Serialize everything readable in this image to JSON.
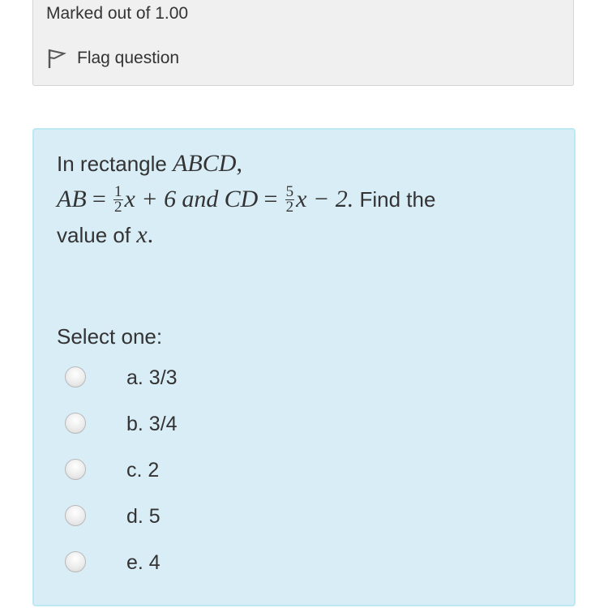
{
  "info": {
    "marked": "Marked out of 1.00",
    "flag_label": "Flag question"
  },
  "question": {
    "intro": "In rectangle",
    "rect_name": "ABCD",
    "ab_label": "AB",
    "equals": "=",
    "frac1_num": "1",
    "frac1_den": "2",
    "expr1": "x + 6",
    "and_word": "and",
    "cd_label": "CD",
    "frac2_num": "5",
    "frac2_den": "2",
    "expr2": "x − 2.",
    "tail": "Find the",
    "value_of": "value of",
    "var": "x"
  },
  "prompt": "Select one:",
  "answers": [
    {
      "label": "a. 3/3"
    },
    {
      "label": "b. 3/4"
    },
    {
      "label": "c. 2"
    },
    {
      "label": "d. 5"
    },
    {
      "label": "e. 4"
    }
  ]
}
